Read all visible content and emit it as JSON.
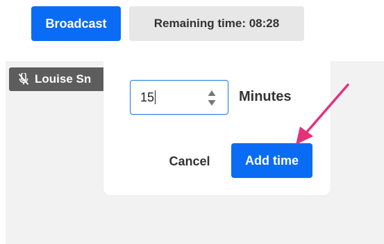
{
  "toolbar": {
    "broadcast_label": "Broadcast",
    "timer_text": "Remaining time: 08:28"
  },
  "participant": {
    "name": "Louise Sn"
  },
  "dialog": {
    "minutes_value": "15",
    "minutes_label": "Minutes",
    "cancel_label": "Cancel",
    "add_time_label": "Add time"
  },
  "icons": {
    "participant": "microphone-off-icon",
    "spinner": "stepper-arrows-icon",
    "annotation": "annotation-arrow-icon"
  },
  "colors": {
    "primary": "#0a6cf5",
    "badge_bg": "#e7e7e7",
    "participant_tag": "#5d5d5d",
    "video_bg": "#f2f2f2",
    "annotation_arrow": "#e5307a"
  }
}
